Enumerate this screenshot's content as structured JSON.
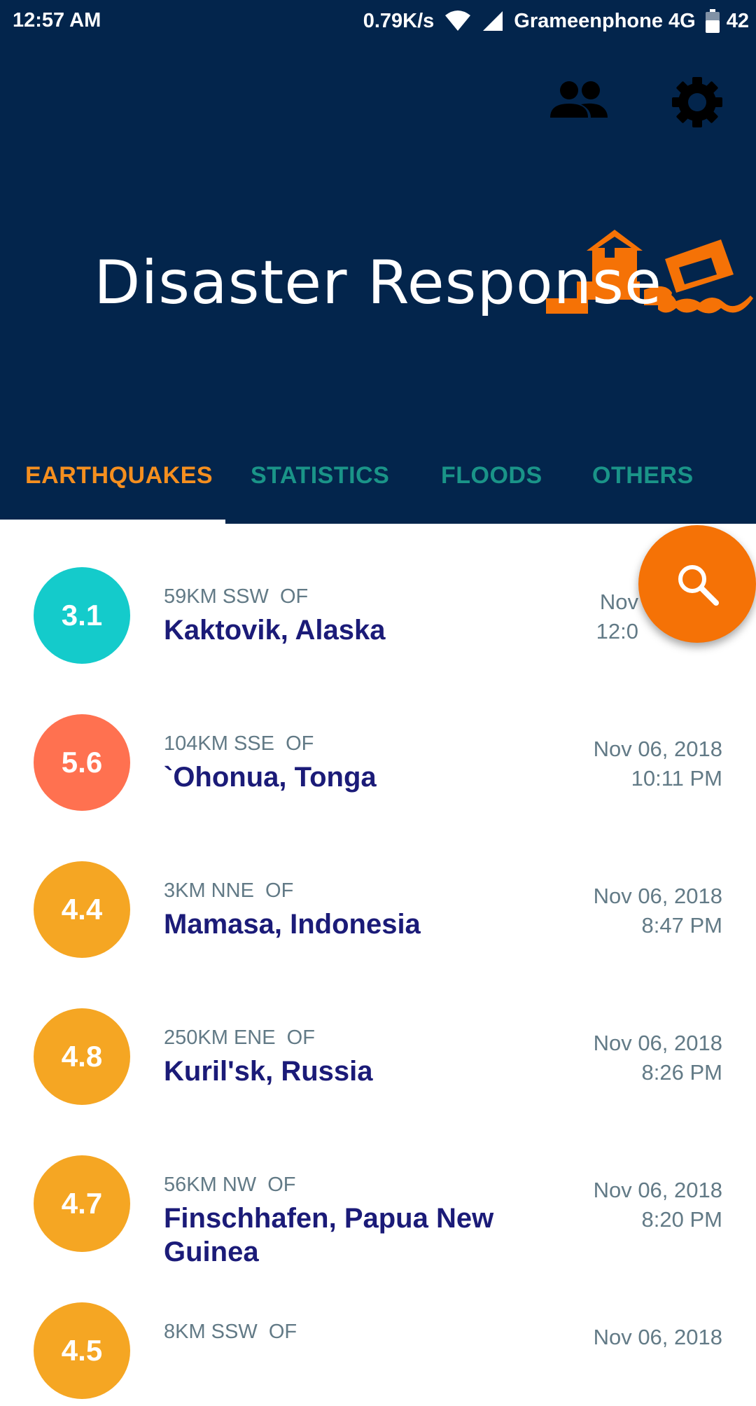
{
  "status_bar": {
    "time": "12:57 AM",
    "speed": "0.79K/s",
    "carrier": "Grameenphone 4G",
    "battery": "42"
  },
  "header": {
    "title": "Disaster Response",
    "icons": [
      "people-icon",
      "gear-icon"
    ],
    "bg_color": "#03254c"
  },
  "tabs": [
    {
      "label": "EARTHQUAKES",
      "active": true
    },
    {
      "label": "STATISTICS",
      "active": false
    },
    {
      "label": "FLOODS",
      "active": false
    },
    {
      "label": "OTHERS",
      "active": false
    }
  ],
  "fab": {
    "icon": "search-icon",
    "color": "#f57206"
  },
  "earthquakes": [
    {
      "magnitude": "3.1",
      "color": "#14cbcb",
      "offset": "59KM SSW  OF",
      "place": "Kaktovik, Alaska",
      "date": "Nov",
      "time": "12:0"
    },
    {
      "magnitude": "5.6",
      "color": "#ff7150",
      "offset": "104KM SSE  OF",
      "place": "`Ohonua, Tonga",
      "date": "Nov 06, 2018",
      "time": "10:11 PM"
    },
    {
      "magnitude": "4.4",
      "color": "#f5a623",
      "offset": "3KM NNE  OF",
      "place": "Mamasa, Indonesia",
      "date": "Nov 06, 2018",
      "time": "8:47 PM"
    },
    {
      "magnitude": "4.8",
      "color": "#f5a623",
      "offset": "250KM ENE  OF",
      "place": "Kuril'sk, Russia",
      "date": "Nov 06, 2018",
      "time": "8:26 PM"
    },
    {
      "magnitude": "4.7",
      "color": "#f5a623",
      "offset": "56KM NW  OF",
      "place": "Finschhafen, Papua New Guinea",
      "date": "Nov 06, 2018",
      "time": "8:20 PM"
    },
    {
      "magnitude": "4.5",
      "color": "#f5a623",
      "offset": "8KM SSW  OF",
      "place": "",
      "date": "Nov 06, 2018",
      "time": ""
    }
  ]
}
